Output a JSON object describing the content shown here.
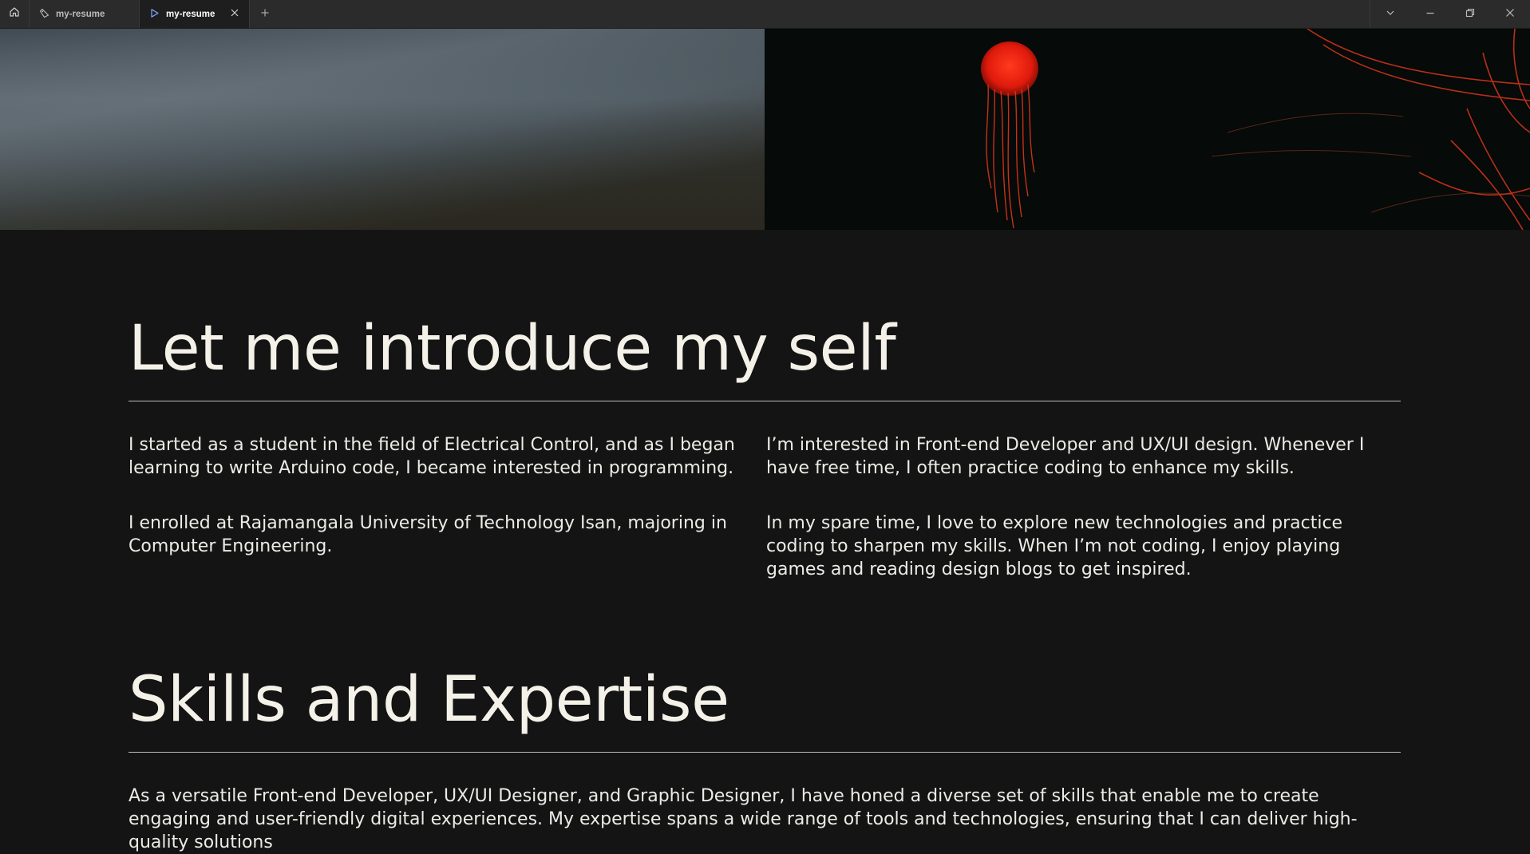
{
  "browser": {
    "tabs": [
      {
        "title": "my-resume",
        "icon": "code-icon",
        "active": false
      },
      {
        "title": "my-resume",
        "icon": "play-icon",
        "active": true
      }
    ]
  },
  "intro": {
    "title": "Let me introduce my self",
    "left": [
      "I started as a student in the field of Electrical Control, and as I began learning to write Arduino code, I became interested in programming.",
      "I enrolled at Rajamangala University of Technology Isan, majoring in Computer Engineering."
    ],
    "right": [
      "I’m interested in Front-end Developer and UX/UI design. Whenever I have free time, I often practice coding to enhance my skills.",
      "In my spare time, I love to explore new technologies and practice coding to sharpen my skills. When I’m not coding, I enjoy playing games and reading design blogs to get inspired."
    ]
  },
  "skills": {
    "title": "Skills and Expertise",
    "description": "As a versatile Front-end Developer, UX/UI Designer, and Graphic Designer, I have honed a diverse set of skills that enable me to create engaging and user-friendly digital experiences. My expertise spans a wide range of tools and technologies, ensuring that I can deliver high-quality solutions"
  },
  "colors": {
    "background": "#141414",
    "text": "#f2f0ea",
    "titlebar": "#2b2b2b",
    "jellyfish": "#ff2a12"
  }
}
